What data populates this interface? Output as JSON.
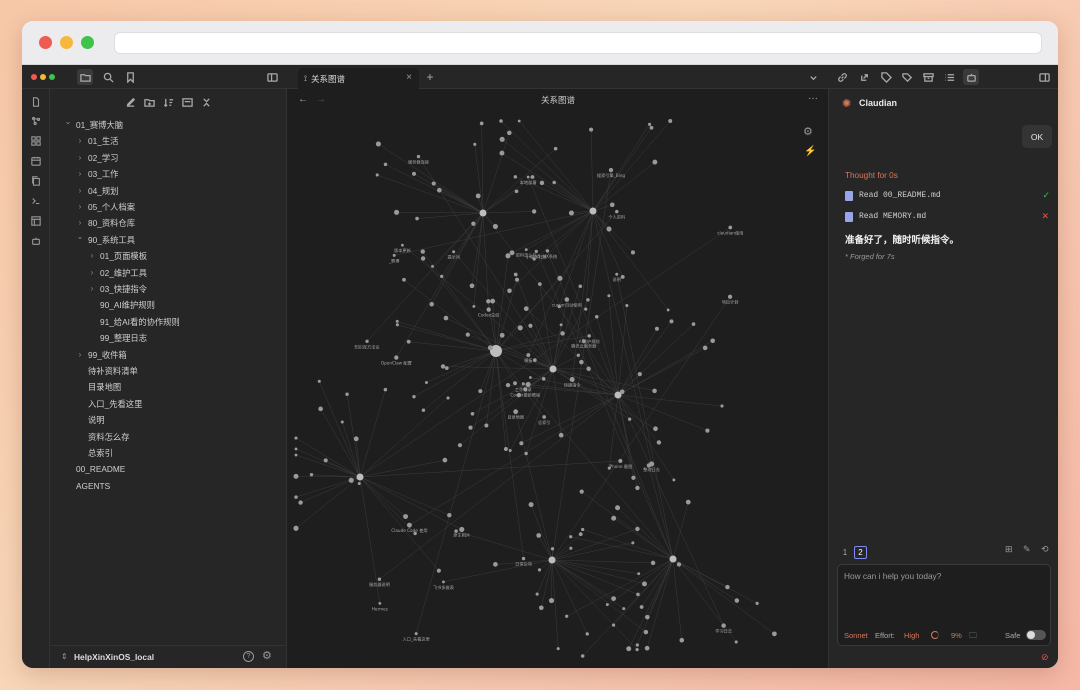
{
  "window": {
    "traffic_lights": [
      "#ef5a53",
      "#f5b83d",
      "#3fc34a"
    ]
  },
  "tab": {
    "title": "关系图谱",
    "icon": "graph-icon"
  },
  "graph": {
    "title": "关系图谱"
  },
  "sidebar": {
    "items": [
      {
        "label": "01_赛博大脑",
        "level": 0,
        "chevron": "open"
      },
      {
        "label": "01_生活",
        "level": 1,
        "chevron": "closed"
      },
      {
        "label": "02_学习",
        "level": 1,
        "chevron": "closed"
      },
      {
        "label": "03_工作",
        "level": 1,
        "chevron": "closed"
      },
      {
        "label": "04_规划",
        "level": 1,
        "chevron": "closed"
      },
      {
        "label": "05_个人档案",
        "level": 1,
        "chevron": "closed"
      },
      {
        "label": "80_资料仓库",
        "level": 1,
        "chevron": "closed"
      },
      {
        "label": "90_系统工具",
        "level": 1,
        "chevron": "open"
      },
      {
        "label": "01_页面模板",
        "level": 2,
        "chevron": "closed"
      },
      {
        "label": "02_维护工具",
        "level": 2,
        "chevron": "closed"
      },
      {
        "label": "03_快捷指令",
        "level": 2,
        "chevron": "closed"
      },
      {
        "label": "90_AI维护规则",
        "level": 2,
        "chevron": "none"
      },
      {
        "label": "91_给AI看的协作规则",
        "level": 2,
        "chevron": "none"
      },
      {
        "label": "99_整理日志",
        "level": 2,
        "chevron": "none"
      },
      {
        "label": "99_收件箱",
        "level": 1,
        "chevron": "closed"
      },
      {
        "label": "待补资料清单",
        "level": 1,
        "chevron": "none"
      },
      {
        "label": "目录地图",
        "level": 1,
        "chevron": "none"
      },
      {
        "label": "入口_先看这里",
        "level": 1,
        "chevron": "none"
      },
      {
        "label": "说明",
        "level": 1,
        "chevron": "none"
      },
      {
        "label": "资料怎么存",
        "level": 1,
        "chevron": "none"
      },
      {
        "label": "总索引",
        "level": 1,
        "chevron": "none"
      },
      {
        "label": "00_README",
        "level": 0,
        "chevron": "none"
      },
      {
        "label": "AGENTS",
        "level": 0,
        "chevron": "none"
      }
    ],
    "vault_name": "HelpXinXinOS_local"
  },
  "claudian": {
    "title": "Claudian",
    "user_message": "OK",
    "thought": "Thought for 0s",
    "files": [
      {
        "name": "Read 00_README.md",
        "status": "success"
      },
      {
        "name": "Read MEMORY.md",
        "status": "error"
      }
    ],
    "reply": "准备好了，随时听候指令。",
    "forged": "* Forged for 7s",
    "tabs": [
      "1",
      "2"
    ],
    "placeholder": "How can i help you today?",
    "model": "Sonnet",
    "effort_label": "Effort:",
    "effort_value": "High",
    "context_percent": "9%",
    "safe_label": "Safe",
    "accent": "#d97757"
  },
  "graph_nodes": [
    {
      "label": "总索引",
      "hub": true
    },
    {
      "label": "_赛博",
      "hub": false
    },
    {
      "label": "Codex最新教程",
      "hub": false
    },
    {
      "label": "服务器说明",
      "hub": false
    },
    {
      "label": "腾讯云服务器",
      "hub": false
    },
    {
      "label": "原生相片",
      "hub": false
    },
    {
      "label": "搜索引擎_Bing",
      "hub": false
    },
    {
      "label": "5_MX系统",
      "hub": false
    },
    {
      "label": "个人资料",
      "hub": false
    },
    {
      "label": "快捷指令",
      "hub": false
    },
    {
      "label": "服务器连接",
      "hub": false
    },
    {
      "label": "学习日志",
      "hub": false
    },
    {
      "label": "OpenClaw 配置",
      "hub": false
    },
    {
      "label": "claudian使用",
      "hub": false
    },
    {
      "label": "目录地图",
      "hub": false
    },
    {
      "label": "说明",
      "hub": false
    },
    {
      "label": "入口_先看这里",
      "hub": false
    },
    {
      "label": "资料怎么存",
      "hub": false
    },
    {
      "label": "cursor自动使用",
      "hub": false
    },
    {
      "label": "Claude Code 使用",
      "hub": false
    },
    {
      "label": "Codex总结",
      "hub": false
    },
    {
      "label": "Hermes",
      "hub": false
    },
    {
      "label": "飞书多维表",
      "hub": false
    },
    {
      "label": "小程序开发",
      "hub": false
    },
    {
      "label": "AI维护规则",
      "hub": false
    },
    {
      "label": "整理日志",
      "hub": false
    },
    {
      "label": "版本更新",
      "hub": false
    },
    {
      "label": "本地部署",
      "hub": false
    },
    {
      "label": "知识库方法论",
      "hub": false
    },
    {
      "label": "iPhone 截图",
      "hub": false
    },
    {
      "label": "项目计划",
      "hub": false
    },
    {
      "label": "工作记录",
      "hub": false
    },
    {
      "label": "日常杂项",
      "hub": false
    },
    {
      "label": "模板",
      "hub": false
    },
    {
      "label": "提示词",
      "hub": false
    }
  ]
}
